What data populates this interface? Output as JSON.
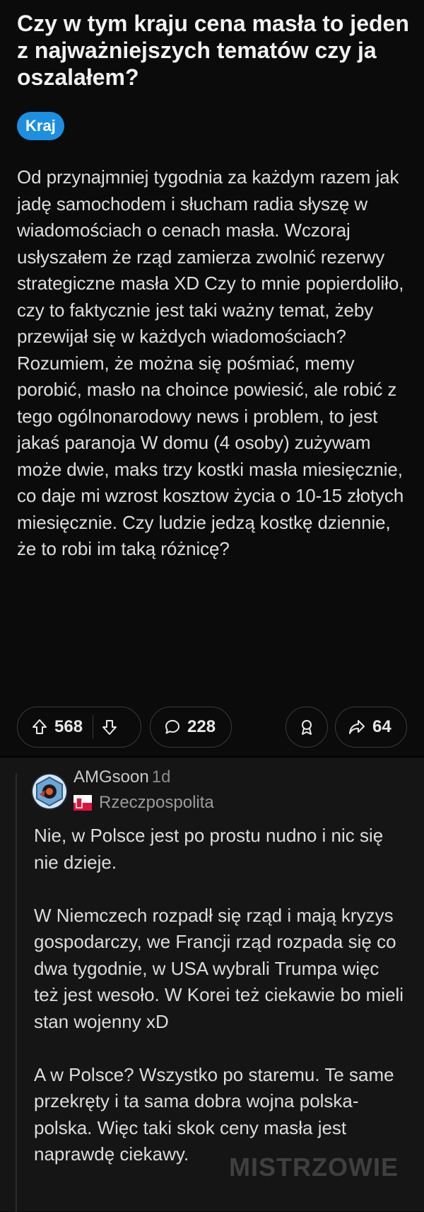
{
  "post": {
    "title": "Czy w tym kraju cena masła to jeden z najważniejszych tematów czy ja oszalałem?",
    "flair": "Kraj",
    "body": "Od przynajmniej tygodnia za każdym razem jak jadę samochodem i słucham radia słyszę w wiadomościach o cenach masła. Wczoraj usłyszałem że rząd zamierza zwolnić rezerwy strategiczne masła XD Czy to mnie popierdoliło, czy to faktycznie jest taki ważny temat, żeby przewijał się w każdych wiadomościach? Rozumiem, że można się pośmiać, memy porobić, masło na choince powiesić, ale robić z tego ogólnonarodowy news i problem, to jest jakaś paranoja W domu (4 osoby) zużywam może dwie, maks trzy kostki masła miesięcznie, co daje mi wzrost kosztow życia o 10-15 złotych miesięcznie. Czy ludzie jedzą kostkę dziennie, że to robi im taką różnicę?",
    "upvotes": "568",
    "comments": "228",
    "shares": "64",
    "icons": {
      "upvote": "arrow-up-icon",
      "downvote": "arrow-down-icon",
      "comment": "speech-bubble-icon",
      "award": "award-ribbon-icon",
      "share": "share-arrow-icon"
    }
  },
  "comment": {
    "username": "AMGsoon",
    "time": "1d",
    "user_flair": "Rzeczpospolita",
    "paragraphs": [
      "Nie, w Polsce jest po prostu nudno i nic się nie dzieje.",
      "W Niemczech rozpadł się rząd i mają kryzys gospodarczy, we Francji rząd rozpada się co dwa tygodnie, w USA wybrali Trumpa więc też jest wesoło. W Korei też ciekawie bo mieli stan wojenny xD",
      "A w Polsce? Wszystko po staremu. Te same przekręty i ta sama dobra wojna polska-polska. Więc taki skok ceny masła jest naprawdę ciekawy."
    ]
  },
  "watermark": "MISTRZOWIE",
  "colors": {
    "flair_bg": "#1d8fe0",
    "background": "#0b0b0c",
    "comment_bg": "#151516"
  }
}
